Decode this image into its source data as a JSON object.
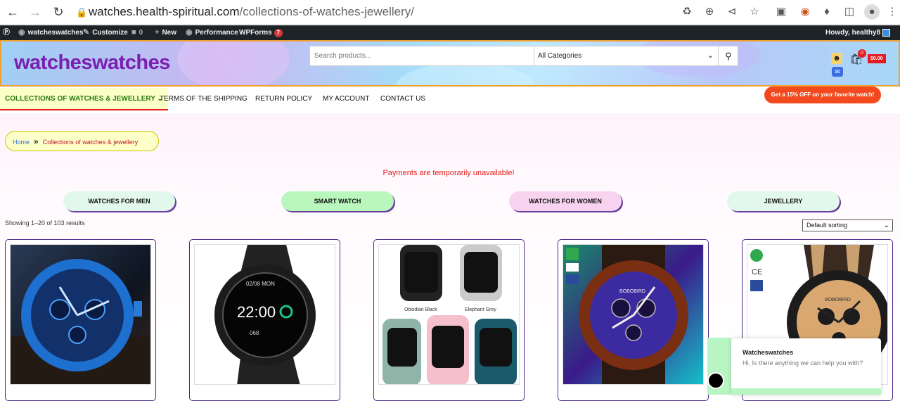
{
  "browser": {
    "url_host": "watches.health-spiritual.com",
    "url_path": "/collections-of-watches-jewellery/"
  },
  "adminbar": {
    "site": "watcheswatches",
    "customize": "Customize",
    "comments": "0",
    "new": "New",
    "performance": "Performance",
    "wpforms": "WPForms",
    "wpforms_badge": "7",
    "howdy": "Howdy, healthy8"
  },
  "header": {
    "logo": "watcheswatches",
    "search_placeholder": "Search products...",
    "category": "All Categories",
    "cart_count": "0",
    "cart_total": "$0.00"
  },
  "nav": {
    "items": [
      "COLLECTIONS OF WATCHES & JEWELLERY",
      "TERMS OF THE SHIPPING",
      "RETURN POLICY",
      "MY ACCOUNT",
      "CONTACT US"
    ],
    "promo": "Get a 15% OFF on your favorite watch!"
  },
  "main": {
    "breadcrumb": {
      "home": "Home",
      "sep": "»",
      "current": "Collections of watches & jewellery"
    },
    "notice": "Payments are temporarily unavailable!",
    "categories": [
      "WATCHES FOR MEN",
      "SMART WATCH",
      "WATCHES FOR WOMEN",
      "JEWELLERY"
    ],
    "results": "Showing 1–20 of 103 results",
    "sorting": "Default sorting",
    "products": [
      {
        "labels": []
      },
      {
        "labels": [
          "02/08 MON",
          "22:00",
          "068"
        ]
      },
      {
        "labels": [
          "Obsidian Black",
          "Elephant Grey"
        ]
      },
      {
        "labels": [
          "BOBOBIRD"
        ]
      },
      {
        "labels": [
          "CE",
          "BOBOBIRD"
        ]
      }
    ]
  },
  "chat": {
    "name": "Watcheswatches",
    "message": "Hi, Is there anything we can help you with?"
  }
}
